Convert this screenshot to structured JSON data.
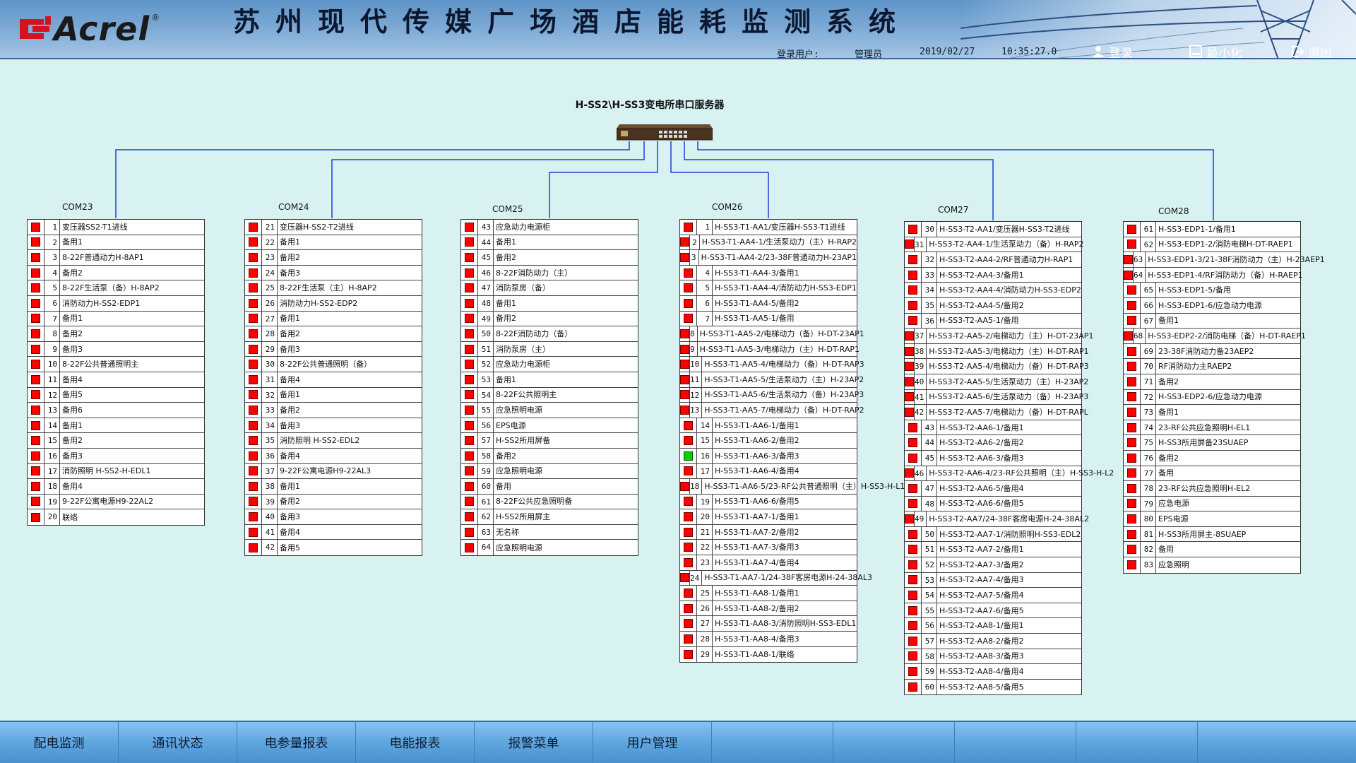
{
  "header": {
    "logo_text": "Acrel",
    "logo_reg": "®",
    "title": "苏州现代传媒广场酒店能耗监测系统",
    "login_user_label": "登录用户:",
    "login_user_value": "管理员",
    "date": "2019/02/27",
    "time": "10:35:27.0",
    "login_btn": "登录",
    "minimize_btn": "最小化",
    "exit_btn": "退出"
  },
  "server": {
    "title": "H-SS2\\H-SS3变电所串口服务器"
  },
  "panels": [
    {
      "com": "COM23",
      "rows": [
        {
          "n": "1",
          "name": "变压器SS2-T1进线",
          "ok": false
        },
        {
          "n": "2",
          "name": "备用1",
          "ok": false
        },
        {
          "n": "3",
          "name": "8-22F普通动力H-8AP1",
          "ok": false
        },
        {
          "n": "4",
          "name": "备用2",
          "ok": false
        },
        {
          "n": "5",
          "name": "8-22F生活泵（备）H-8AP2",
          "ok": false
        },
        {
          "n": "6",
          "name": "消防动力H-SS2-EDP1",
          "ok": false
        },
        {
          "n": "7",
          "name": "备用1",
          "ok": false
        },
        {
          "n": "8",
          "name": "备用2",
          "ok": false
        },
        {
          "n": "9",
          "name": "备用3",
          "ok": false
        },
        {
          "n": "10",
          "name": "8-22F公共普通照明主",
          "ok": false
        },
        {
          "n": "11",
          "name": "备用4",
          "ok": false
        },
        {
          "n": "12",
          "name": "备用5",
          "ok": false
        },
        {
          "n": "13",
          "name": "备用6",
          "ok": false
        },
        {
          "n": "14",
          "name": "备用1",
          "ok": false
        },
        {
          "n": "15",
          "name": "备用2",
          "ok": false
        },
        {
          "n": "16",
          "name": "备用3",
          "ok": false
        },
        {
          "n": "17",
          "name": "消防照明 H-SS2-H-EDL1",
          "ok": false
        },
        {
          "n": "18",
          "name": "备用4",
          "ok": false
        },
        {
          "n": "19",
          "name": "9-22F公寓电源H9-22AL2",
          "ok": false
        },
        {
          "n": "20",
          "name": "联络",
          "ok": false
        }
      ]
    },
    {
      "com": "COM24",
      "rows": [
        {
          "n": "21",
          "name": "变压器H-SS2-T2进线",
          "ok": false
        },
        {
          "n": "22",
          "name": "备用1",
          "ok": false
        },
        {
          "n": "23",
          "name": "备用2",
          "ok": false
        },
        {
          "n": "24",
          "name": "备用3",
          "ok": false
        },
        {
          "n": "25",
          "name": "8-22F生活泵（主）H-8AP2",
          "ok": false
        },
        {
          "n": "26",
          "name": "消防动力H-SS2-EDP2",
          "ok": false
        },
        {
          "n": "27",
          "name": "备用1",
          "ok": false
        },
        {
          "n": "28",
          "name": "备用2",
          "ok": false
        },
        {
          "n": "29",
          "name": "备用3",
          "ok": false
        },
        {
          "n": "30",
          "name": "8-22F公共普通照明（备）",
          "ok": false
        },
        {
          "n": "31",
          "name": "备用4",
          "ok": false
        },
        {
          "n": "32",
          "name": "备用1",
          "ok": false
        },
        {
          "n": "33",
          "name": "备用2",
          "ok": false
        },
        {
          "n": "34",
          "name": "备用3",
          "ok": false
        },
        {
          "n": "35",
          "name": "消防照明 H-SS2-EDL2",
          "ok": false
        },
        {
          "n": "36",
          "name": "备用4",
          "ok": false
        },
        {
          "n": "37",
          "name": "9-22F公寓电源H9-22AL3",
          "ok": false
        },
        {
          "n": "38",
          "name": "备用1",
          "ok": false
        },
        {
          "n": "39",
          "name": "备用2",
          "ok": false
        },
        {
          "n": "40",
          "name": "备用3",
          "ok": false
        },
        {
          "n": "41",
          "name": "备用4",
          "ok": false
        },
        {
          "n": "42",
          "name": "备用5",
          "ok": false
        }
      ]
    },
    {
      "com": "COM25",
      "rows": [
        {
          "n": "43",
          "name": "应急动力电源柜",
          "ok": false
        },
        {
          "n": "44",
          "name": "备用1",
          "ok": false
        },
        {
          "n": "45",
          "name": "备用2",
          "ok": false
        },
        {
          "n": "46",
          "name": "8-22F消防动力（主）",
          "ok": false
        },
        {
          "n": "47",
          "name": "消防泵房（备）",
          "ok": false
        },
        {
          "n": "48",
          "name": "备用1",
          "ok": false
        },
        {
          "n": "49",
          "name": "备用2",
          "ok": false
        },
        {
          "n": "50",
          "name": "8-22F消防动力（备）",
          "ok": false
        },
        {
          "n": "51",
          "name": "消防泵房（主）",
          "ok": false
        },
        {
          "n": "52",
          "name": "应急动力电源柜",
          "ok": false
        },
        {
          "n": "53",
          "name": "备用1",
          "ok": false
        },
        {
          "n": "54",
          "name": "8-22F公共照明主",
          "ok": false
        },
        {
          "n": "55",
          "name": "应急照明电源",
          "ok": false
        },
        {
          "n": "56",
          "name": "EPS电源",
          "ok": false
        },
        {
          "n": "57",
          "name": "H-SS2所用屏备",
          "ok": false
        },
        {
          "n": "58",
          "name": "备用2",
          "ok": false
        },
        {
          "n": "59",
          "name": "应急照明电源",
          "ok": false
        },
        {
          "n": "60",
          "name": "备用",
          "ok": false
        },
        {
          "n": "61",
          "name": "8-22F公共应急照明备",
          "ok": false
        },
        {
          "n": "62",
          "name": "H-SS2所用屏主",
          "ok": false
        },
        {
          "n": "63",
          "name": "无名称",
          "ok": false
        },
        {
          "n": "64",
          "name": "应急照明电源",
          "ok": false
        }
      ]
    },
    {
      "com": "COM26",
      "rows": [
        {
          "n": "1",
          "name": "H-SS3-T1-AA1/变压器H-SS3-T1进线",
          "ok": false
        },
        {
          "n": "2",
          "name": "H-SS3-T1-AA4-1/生活泵动力（主）H-RAP2",
          "ok": false
        },
        {
          "n": "3",
          "name": "H-SS3-T1-AA4-2/23-38F普通动力H-23AP1",
          "ok": false
        },
        {
          "n": "4",
          "name": "H-SS3-T1-AA4-3/备用1",
          "ok": false
        },
        {
          "n": "5",
          "name": "H-SS3-T1-AA4-4/消防动力H-SS3-EDP1",
          "ok": false
        },
        {
          "n": "6",
          "name": "H-SS3-T1-AA4-5/备用2",
          "ok": false
        },
        {
          "n": "7",
          "name": "H-SS3-T1-AA5-1/备用",
          "ok": false
        },
        {
          "n": "8",
          "name": "H-SS3-T1-AA5-2/电梯动力（备）H-DT-23AP1",
          "ok": false
        },
        {
          "n": "9",
          "name": "H-SS3-T1-AA5-3/电梯动力（主）H-DT-RAP1",
          "ok": false
        },
        {
          "n": "10",
          "name": "H-SS3-T1-AA5-4/电梯动力（备）H-DT-RAP3",
          "ok": false
        },
        {
          "n": "11",
          "name": "H-SS3-T1-AA5-5/生活泵动力（主）H-23AP2",
          "ok": false
        },
        {
          "n": "12",
          "name": "H-SS3-T1-AA5-6/生活泵动力（备）H-23AP3",
          "ok": false
        },
        {
          "n": "13",
          "name": "H-SS3-T1-AA5-7/电梯动力（备）H-DT-RAP2",
          "ok": false
        },
        {
          "n": "14",
          "name": "H-SS3-T1-AA6-1/备用1",
          "ok": false
        },
        {
          "n": "15",
          "name": "H-SS3-T1-AA6-2/备用2",
          "ok": false
        },
        {
          "n": "16",
          "name": "H-SS3-T1-AA6-3/备用3",
          "ok": true
        },
        {
          "n": "17",
          "name": "H-SS3-T1-AA6-4/备用4",
          "ok": false
        },
        {
          "n": "18",
          "name": "H-SS3-T1-AA6-5/23-RF公共普通照明（主）H-SS3-H-L1",
          "ok": false
        },
        {
          "n": "19",
          "name": "H-SS3-T1-AA6-6/备用5",
          "ok": false
        },
        {
          "n": "20",
          "name": "H-SS3-T1-AA7-1/备用1",
          "ok": false
        },
        {
          "n": "21",
          "name": "H-SS3-T1-AA7-2/备用2",
          "ok": false
        },
        {
          "n": "22",
          "name": "H-SS3-T1-AA7-3/备用3",
          "ok": false
        },
        {
          "n": "23",
          "name": "H-SS3-T1-AA7-4/备用4",
          "ok": false
        },
        {
          "n": "24",
          "name": "H-SS3-T1-AA7-1/24-38F客房电源H-24-38AL3",
          "ok": false
        },
        {
          "n": "25",
          "name": "H-SS3-T1-AA8-1/备用1",
          "ok": false
        },
        {
          "n": "26",
          "name": "H-SS3-T1-AA8-2/备用2",
          "ok": false
        },
        {
          "n": "27",
          "name": "H-SS3-T1-AA8-3/消防照明H-SS3-EDL1",
          "ok": false
        },
        {
          "n": "28",
          "name": "H-SS3-T1-AA8-4/备用3",
          "ok": false
        },
        {
          "n": "29",
          "name": "H-SS3-T1-AA8-1/联络",
          "ok": false
        }
      ]
    },
    {
      "com": "COM27",
      "rows": [
        {
          "n": "30",
          "name": "H-SS3-T2-AA1/变压器H-SS3-T2进线",
          "ok": false
        },
        {
          "n": "31",
          "name": "H-SS3-T2-AA4-1/生活泵动力（备）H-RAP2",
          "ok": false
        },
        {
          "n": "32",
          "name": "H-SS3-T2-AA4-2/RF普通动力H-RAP1",
          "ok": false
        },
        {
          "n": "33",
          "name": "H-SS3-T2-AA4-3/备用1",
          "ok": false
        },
        {
          "n": "34",
          "name": "H-SS3-T2-AA4-4/消防动力H-SS3-EDP2",
          "ok": false
        },
        {
          "n": "35",
          "name": "H-SS3-T2-AA4-5/备用2",
          "ok": false
        },
        {
          "n": "36",
          "name": "H-SS3-T2-AA5-1/备用",
          "ok": false
        },
        {
          "n": "37",
          "name": "H-SS3-T2-AA5-2/电梯动力（主）H-DT-23AP1",
          "ok": false
        },
        {
          "n": "38",
          "name": "H-SS3-T2-AA5-3/电梯动力（主）H-DT-RAP1",
          "ok": false
        },
        {
          "n": "39",
          "name": "H-SS3-T2-AA5-4/电梯动力（备）H-DT-RAP3",
          "ok": false
        },
        {
          "n": "40",
          "name": "H-SS3-T2-AA5-5/生活泵动力（主）H-23AP2",
          "ok": false
        },
        {
          "n": "41",
          "name": "H-SS3-T2-AA5-6/生活泵动力（备）H-23AP3",
          "ok": false
        },
        {
          "n": "42",
          "name": "H-SS3-T2-AA5-7/电梯动力（备）H-DT-RAPL",
          "ok": false
        },
        {
          "n": "43",
          "name": "H-SS3-T2-AA6-1/备用1",
          "ok": false
        },
        {
          "n": "44",
          "name": "H-SS3-T2-AA6-2/备用2",
          "ok": false
        },
        {
          "n": "45",
          "name": "H-SS3-T2-AA6-3/备用3",
          "ok": false
        },
        {
          "n": "46",
          "name": "H-SS3-T2-AA6-4/23-RF公共照明（主）H-SS3-H-L2",
          "ok": false
        },
        {
          "n": "47",
          "name": "H-SS3-T2-AA6-5/备用4",
          "ok": false
        },
        {
          "n": "48",
          "name": "H-SS3-T2-AA6-6/备用5",
          "ok": false
        },
        {
          "n": "49",
          "name": "H-SS3-T2-AA7/24-38F客房电源H-24-38AL2",
          "ok": false
        },
        {
          "n": "50",
          "name": "H-SS3-T2-AA7-1/消防照明H-SS3-EDL2",
          "ok": false
        },
        {
          "n": "51",
          "name": "H-SS3-T2-AA7-2/备用1",
          "ok": false
        },
        {
          "n": "52",
          "name": "H-SS3-T2-AA7-3/备用2",
          "ok": false
        },
        {
          "n": "53",
          "name": "H-SS3-T2-AA7-4/备用3",
          "ok": false
        },
        {
          "n": "54",
          "name": "H-SS3-T2-AA7-5/备用4",
          "ok": false
        },
        {
          "n": "55",
          "name": "H-SS3-T2-AA7-6/备用5",
          "ok": false
        },
        {
          "n": "56",
          "name": "H-SS3-T2-AA8-1/备用1",
          "ok": false
        },
        {
          "n": "57",
          "name": "H-SS3-T2-AA8-2/备用2",
          "ok": false
        },
        {
          "n": "58",
          "name": "H-SS3-T2-AA8-3/备用3",
          "ok": false
        },
        {
          "n": "59",
          "name": "H-SS3-T2-AA8-4/备用4",
          "ok": false
        },
        {
          "n": "60",
          "name": "H-SS3-T2-AA8-5/备用5",
          "ok": false
        }
      ]
    },
    {
      "com": "COM28",
      "rows": [
        {
          "n": "61",
          "name": "H-SS3-EDP1-1/备用1",
          "ok": false
        },
        {
          "n": "62",
          "name": "H-SS3-EDP1-2/消防电梯H-DT-RAEP1",
          "ok": false
        },
        {
          "n": "63",
          "name": "H-SS3-EDP1-3/21-38F消防动力（主）H-23AEP1",
          "ok": false
        },
        {
          "n": "64",
          "name": "H-SS3-EDP1-4/RF消防动力（备）H-RAEP1",
          "ok": false
        },
        {
          "n": "65",
          "name": "H-SS3-EDP1-5/备用",
          "ok": false
        },
        {
          "n": "66",
          "name": "H-SS3-EDP1-6/应急动力电源",
          "ok": false
        },
        {
          "n": "67",
          "name": "备用1",
          "ok": false
        },
        {
          "n": "68",
          "name": "H-SS3-EDP2-2/消防电梯（备）H-DT-RAEP1",
          "ok": false
        },
        {
          "n": "69",
          "name": "23-38F消防动力备23AEP2",
          "ok": false
        },
        {
          "n": "70",
          "name": "RF消防动力主RAEP2",
          "ok": false
        },
        {
          "n": "71",
          "name": "备用2",
          "ok": false
        },
        {
          "n": "72",
          "name": "H-SS3-EDP2-6/应急动力电源",
          "ok": false
        },
        {
          "n": "73",
          "name": "备用1",
          "ok": false
        },
        {
          "n": "74",
          "name": "23-RF公共应急照明H-EL1",
          "ok": false
        },
        {
          "n": "75",
          "name": "H-SS3所用屏备23SUAEP",
          "ok": false
        },
        {
          "n": "76",
          "name": "备用2",
          "ok": false
        },
        {
          "n": "77",
          "name": "备用",
          "ok": false
        },
        {
          "n": "78",
          "name": "23-RF公共应急照明H-EL2",
          "ok": false
        },
        {
          "n": "79",
          "name": "应急电源",
          "ok": false
        },
        {
          "n": "80",
          "name": "EPS电源",
          "ok": false
        },
        {
          "n": "81",
          "name": "H-SS3所用屏主-8SUAEP",
          "ok": false
        },
        {
          "n": "82",
          "name": "备用",
          "ok": false
        },
        {
          "n": "83",
          "name": "应急照明",
          "ok": false
        }
      ]
    }
  ],
  "footer": {
    "tabs": [
      "配电监测",
      "通讯状态",
      "电参量报表",
      "电能报表",
      "报警菜单",
      "用户管理",
      "",
      "",
      "",
      "",
      ""
    ]
  },
  "colors": {
    "alarm": "#ff0000",
    "ok": "#00d000",
    "wire": "#1f3fd8",
    "background": "#d8f2f2"
  }
}
